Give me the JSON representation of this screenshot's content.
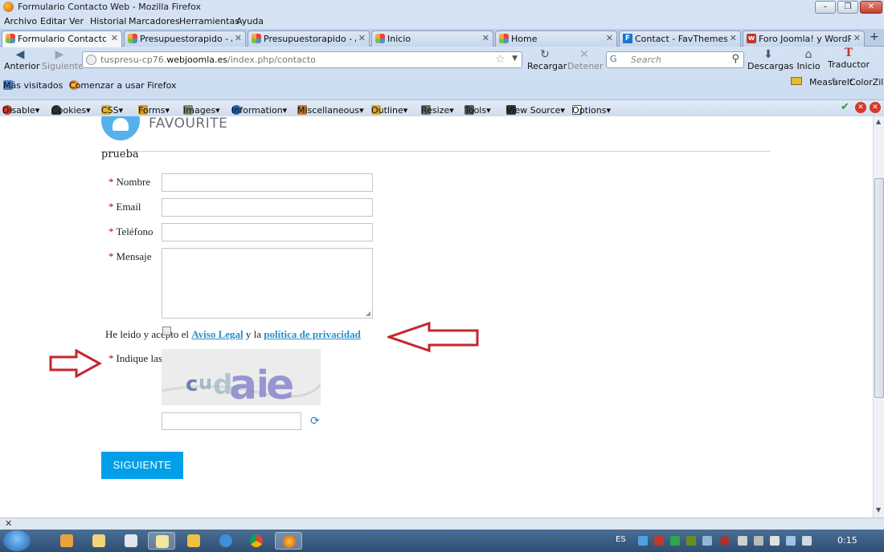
{
  "window": {
    "title": "Formulario Contacto Web - Mozilla Firefox",
    "controls": [
      "–",
      "❐",
      "✕"
    ]
  },
  "menu": [
    "Archivo",
    "Editar",
    "Ver",
    "Historial",
    "Marcadores",
    "Herramientas",
    "Ayuda"
  ],
  "tabs": [
    {
      "label": "Formulario Contacto W...",
      "icon": "joomla-icon",
      "active": true
    },
    {
      "label": "Presupuestorapido - Ad...",
      "icon": "joomla-icon",
      "active": false
    },
    {
      "label": "Presupuestorapido - Ad...",
      "icon": "joomla-icon",
      "active": false
    },
    {
      "label": "Inicio",
      "icon": "joomla-icon",
      "active": false
    },
    {
      "label": "Home",
      "icon": "joomla-icon",
      "active": false
    },
    {
      "label": "Contact - FavThemes - ...",
      "icon": "favthemes-icon",
      "active": false
    },
    {
      "label": "Foro Joomla! y WordPre...",
      "icon": "forum-icon",
      "active": false
    }
  ],
  "nav": {
    "back": "Anterior",
    "forward": "Siguiente",
    "reload": "Recargar",
    "stop": "Detener",
    "downloads": "Descargas",
    "home": "Inicio",
    "translator": "Traductor",
    "translator_icon": "T",
    "measureit": "MeasureIt",
    "colorzilla": "ColorZilla"
  },
  "urlbar": {
    "prefix": "tuspresu-cp76.",
    "domain": "webjoomla.es",
    "path": "/index.php/contacto"
  },
  "search": {
    "placeholder": "Search",
    "engine": "G"
  },
  "bookmarks": {
    "most_visited": "Más visitados",
    "getting_started": "Comenzar a usar Firefox"
  },
  "devbar": [
    "Disable▾",
    "Cookies▾",
    "CSS▾",
    "Forms▾",
    "Images▾",
    "Information▾",
    "Miscellaneous▾",
    "Outline▾",
    "Resize▾",
    "Tools▾",
    "View Source▾",
    "Options▾"
  ],
  "page": {
    "logo_text": "FAVOURITE",
    "form_title": "prueba",
    "required_mark": "*",
    "fields": {
      "name": "Nombre",
      "email": "Email",
      "phone": "Teléfono",
      "message": "Mensaje"
    },
    "legal": {
      "text_before": "He leido y acepto el ",
      "aviso": "Aviso Legal",
      "text_middle": " y la ",
      "privacy": "política de privacidad"
    },
    "captcha_label": "Indique las",
    "submit": "SIGUIENTE"
  },
  "colors": {
    "accent": "#009fe8",
    "link": "#2a8fc8",
    "required": "#cc0000",
    "arrow": "#c4262e"
  },
  "taskbar": {
    "lang": "ES",
    "clock": "0:15"
  }
}
